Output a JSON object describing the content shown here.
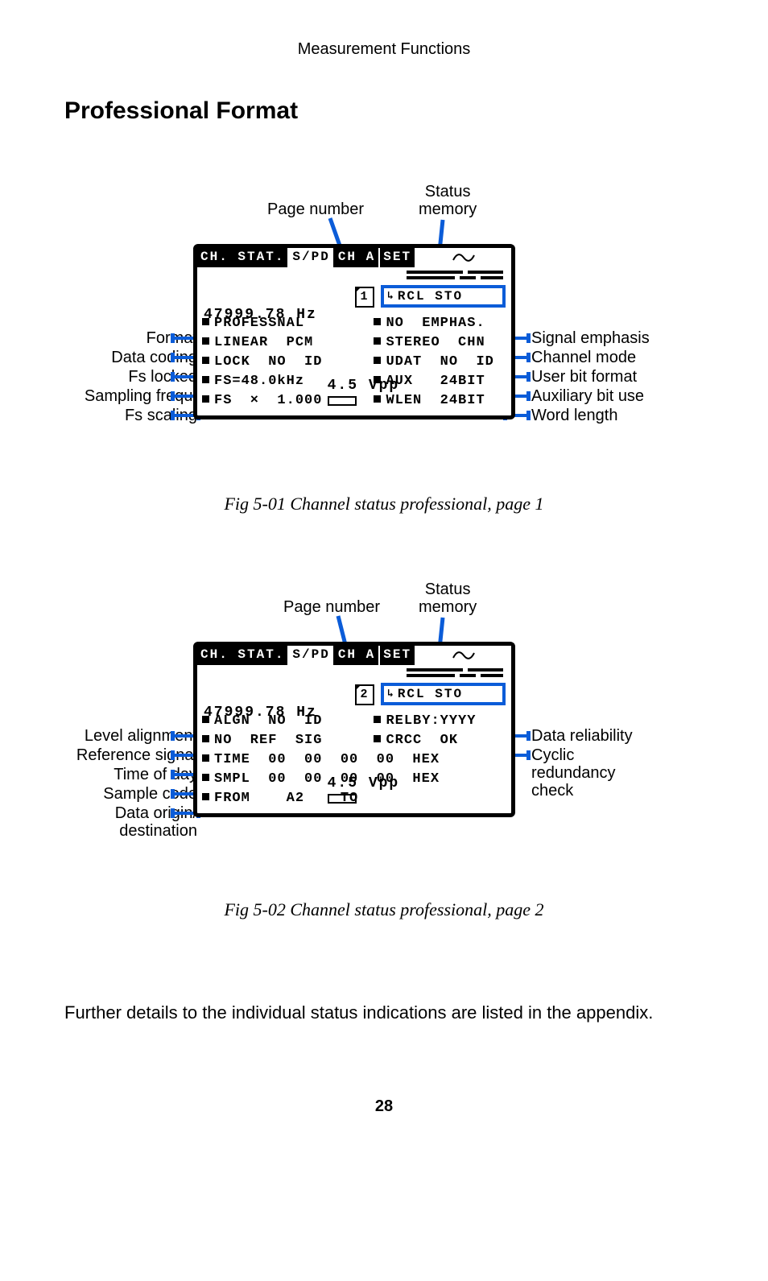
{
  "page": {
    "running_head": "Measurement Functions",
    "section_title": "Professional Format",
    "body_text": "Further details to the individual status indications are listed in the appendix.",
    "page_number": "28"
  },
  "fig1": {
    "caption": "Fig 5-01  Channel status professional, page 1",
    "call_top": {
      "page_number": "Page number",
      "status_memory": "Status\nmemory"
    },
    "lcd": {
      "titlebar": {
        "title": "CH. STAT.",
        "spd": "S/PD",
        "cha": "CH A",
        "set": "SET"
      },
      "freq": "47999.78 Hz",
      "level": "4.5 Vpp",
      "page_num": "1",
      "rcl_sto": "RCL  STO",
      "rows": [
        {
          "left": "PROFESSNAL",
          "right": "NO  EMPHAS."
        },
        {
          "left": "LINEAR  PCM",
          "right": "STEREO  CHN"
        },
        {
          "left": "LOCK  NO  ID",
          "right": "UDAT  NO  ID"
        },
        {
          "left": "FS=48.0kHz",
          "right": "AUX   24BIT"
        },
        {
          "left": "FS  ×  1.000",
          "right": "WLEN  24BIT"
        }
      ]
    },
    "labels_left": [
      "Format",
      "Data coding",
      "Fs locked",
      "Sampling frequ.",
      "Fs  scaling"
    ],
    "labels_right": [
      "Signal emphasis",
      "Channel mode",
      "User bit format",
      "Auxiliary bit use",
      "Word length"
    ]
  },
  "fig2": {
    "caption": "Fig 5-02  Channel status professional, page 2",
    "call_top": {
      "page_number": "Page number",
      "status_memory": "Status\nmemory"
    },
    "lcd": {
      "titlebar": {
        "title": "CH. STAT.",
        "spd": "S/PD",
        "cha": "CH A",
        "set": "SET"
      },
      "freq": "47999.78 Hz",
      "level": "4.5 Vpp",
      "page_num": "2",
      "rcl_sto": "RCL  STO",
      "rows": [
        {
          "left": "ALGN  NO  ID",
          "right": "RELBY:YYYY"
        },
        {
          "left": "NO  REF  SIG",
          "right": "CRCC  OK"
        },
        {
          "left": "TIME  00  00  00  00  HEX",
          "right": ""
        },
        {
          "left": "SMPL  00  00  00  00  HEX",
          "right": ""
        },
        {
          "left": "FROM    A2    TO",
          "right": ""
        }
      ]
    },
    "labels_left": [
      "Level alignment",
      "Reference signal",
      "Time of day",
      "Sample code",
      "Data origin/\ndestination"
    ],
    "labels_right": [
      "Data reliability",
      "Cyclic\nredundancy\ncheck"
    ]
  }
}
